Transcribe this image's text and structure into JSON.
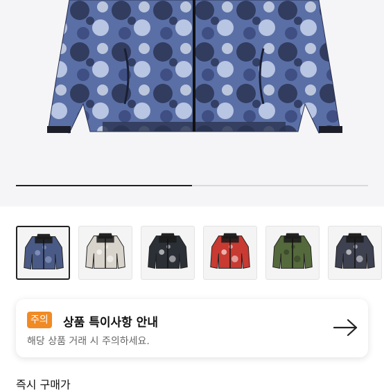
{
  "product": {
    "selected_image_index": 0,
    "gallery_progress": 0.5,
    "thumbnails": [
      {
        "icon": "jacket-icon",
        "pattern": "tie-dye",
        "color": "#4a5a86"
      },
      {
        "icon": "jacket-icon",
        "pattern": "bandana",
        "color": "#d8d3cb"
      },
      {
        "icon": "jacket-icon",
        "pattern": "bandana",
        "color": "#2b2f36"
      },
      {
        "icon": "jacket-icon",
        "pattern": "bandana",
        "color": "#c83a32"
      },
      {
        "icon": "jacket-icon",
        "pattern": "camo",
        "color": "#556a3c"
      },
      {
        "icon": "jacket-icon",
        "pattern": "paisley",
        "color": "#3e4150"
      }
    ]
  },
  "notice": {
    "badge": "주의",
    "title": "상품 특이사항 안내",
    "subtitle": "해당 상품 거래 시 주의하세요.",
    "arrow_icon": "arrow-right-icon",
    "badge_color": "#f08a24"
  },
  "section": {
    "next_label": "즉시 구매가"
  }
}
